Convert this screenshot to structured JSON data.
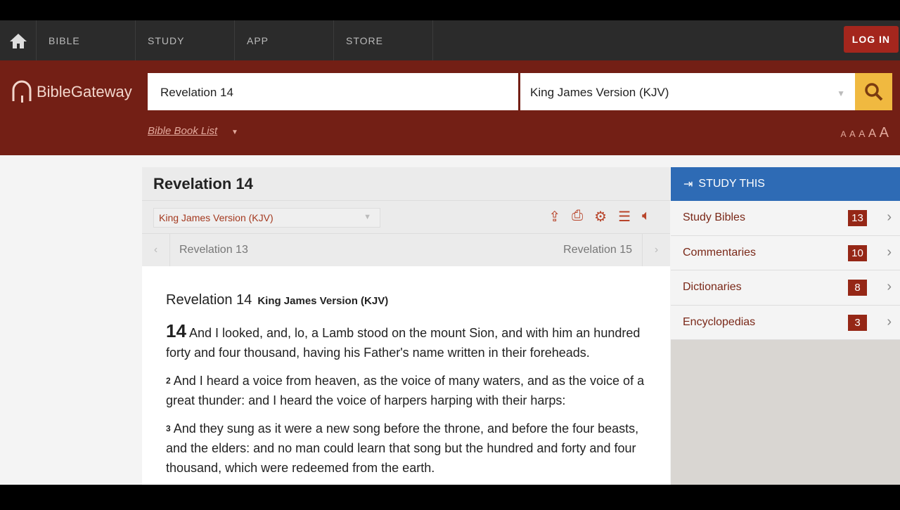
{
  "topnav": {
    "items": [
      "BIBLE",
      "STUDY",
      "APP",
      "STORE"
    ],
    "login": "LOG IN"
  },
  "header": {
    "logo": "BibleGateway",
    "search_value": "Revelation 14",
    "version": "King James Version (KJV)",
    "book_list": "Bible Book List",
    "font_sizes": [
      "A",
      "A",
      "A",
      "A",
      "A"
    ]
  },
  "passage": {
    "title": "Revelation 14",
    "version_select": "King James Version (KJV)",
    "prev": "Revelation 13",
    "next": "Revelation 15",
    "heading": "Revelation 14",
    "heading_version": "King James Version (KJV)",
    "verses": [
      {
        "num": "14",
        "text": "And I looked, and, lo, a Lamb stood on the mount Sion, and with him an hundred forty and four thousand, having his Father's name written in their foreheads."
      },
      {
        "num": "2",
        "text": "And I heard a voice from heaven, as the voice of many waters, and as the voice of a great thunder: and I heard the voice of harpers harping with their harps:"
      },
      {
        "num": "3",
        "text": "And they sung as it were a new song before the throne, and before the four beasts, and the elders: and no man could learn that song but the hundred and forty and four thousand, which were redeemed from the earth."
      }
    ]
  },
  "study": {
    "title": "STUDY THIS",
    "items": [
      {
        "label": "Study Bibles",
        "count": "13"
      },
      {
        "label": "Commentaries",
        "count": "10"
      },
      {
        "label": "Dictionaries",
        "count": "8"
      },
      {
        "label": "Encyclopedias",
        "count": "3"
      }
    ]
  },
  "colors": {
    "header": "#731f15",
    "nav": "#2b2b2b",
    "study": "#2e6bb5",
    "search_btn": "#f0b940",
    "badge": "#952716"
  }
}
